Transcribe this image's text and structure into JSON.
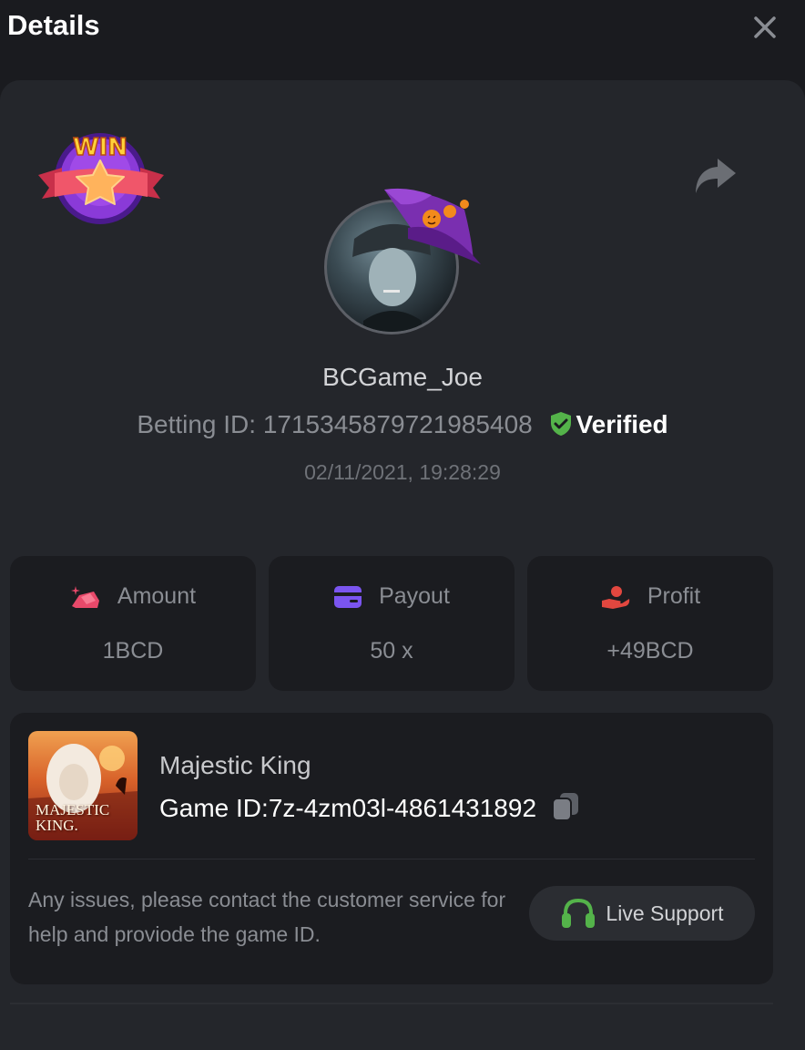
{
  "header": {
    "title": "Details",
    "close_icon": "close-icon"
  },
  "badge": {
    "text": "WIN"
  },
  "user": {
    "name": "BCGame_Joe",
    "betting_id_label": "Betting ID:",
    "betting_id": "1715345879721985408",
    "verified_label": "Verified",
    "date": "02/11/2021, 19:28:29"
  },
  "stats": [
    {
      "label": "Amount",
      "value": "1BCD",
      "icon": "amount-icon",
      "color": "#e8496a"
    },
    {
      "label": "Payout",
      "value": "50 x",
      "icon": "card-icon",
      "color": "#7b55f0"
    },
    {
      "label": "Profit",
      "value": "+49BCD",
      "icon": "profit-hand-icon",
      "color": "#e2473f"
    }
  ],
  "game": {
    "name": "Majestic King",
    "id_label": "Game ID:",
    "id": "7z-4zm03l-4861431892",
    "thumb_line1": "MAJESTIC",
    "thumb_line2": "KING."
  },
  "support": {
    "help_text": "Any issues, please contact the customer service for help and proviode the game ID.",
    "button_label": "Live Support"
  },
  "colors": {
    "accent_green": "#54b34a",
    "panel": "#24262b",
    "card": "#1b1c20"
  }
}
